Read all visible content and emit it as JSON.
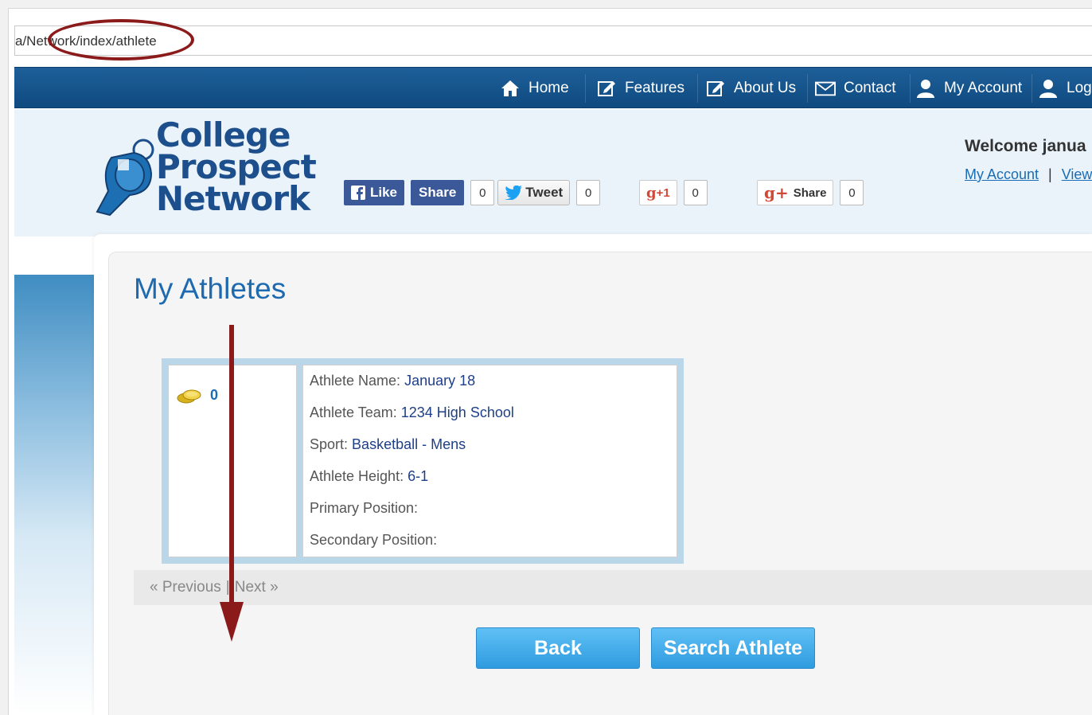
{
  "browser": {
    "url": "a/Network/index/athlete"
  },
  "nav": {
    "items": [
      {
        "label": "Home",
        "icon": "home-icon"
      },
      {
        "label": "Features",
        "icon": "edit-icon"
      },
      {
        "label": "About Us",
        "icon": "edit-icon"
      },
      {
        "label": "Contact",
        "icon": "envelope-icon"
      },
      {
        "label": "My Account",
        "icon": "user-icon"
      },
      {
        "label": "Log",
        "icon": "user-icon"
      }
    ]
  },
  "logo": {
    "line1": "College",
    "line2": "Prospect",
    "line3": "Network"
  },
  "social": {
    "like_label": "Like",
    "share_label": "Share",
    "fb_count": "0",
    "tweet_label": "Tweet",
    "tweet_count": "0",
    "gplus_label": "+1",
    "gplus_count": "0",
    "gshare_label": "Share",
    "gshare_count": "0"
  },
  "welcome": {
    "text": "Welcome janua",
    "my_account_link": "My Account",
    "separator": "|",
    "view_link": "View"
  },
  "page": {
    "title": "My Athletes"
  },
  "athlete": {
    "coins": "0",
    "rows": [
      {
        "label": "Athlete Name:",
        "value": "January 18"
      },
      {
        "label": "Athlete Team:",
        "value": "1234 High School"
      },
      {
        "label": "Sport:",
        "value": "Basketball - Mens"
      },
      {
        "label": "Athlete Height:",
        "value": "6-1"
      },
      {
        "label": "Primary Position:",
        "value": ""
      },
      {
        "label": "Secondary Position:",
        "value": ""
      }
    ]
  },
  "pager": {
    "previous": "« Previous",
    "separator": "|",
    "next": "Next »"
  },
  "buttons": {
    "back": "Back",
    "search": "Search Athlete"
  },
  "colors": {
    "nav_bg": "#1e5f99",
    "title_blue": "#1e6ab0",
    "button_blue": "#2f9be0",
    "annotation_red": "#8b1a1a"
  }
}
